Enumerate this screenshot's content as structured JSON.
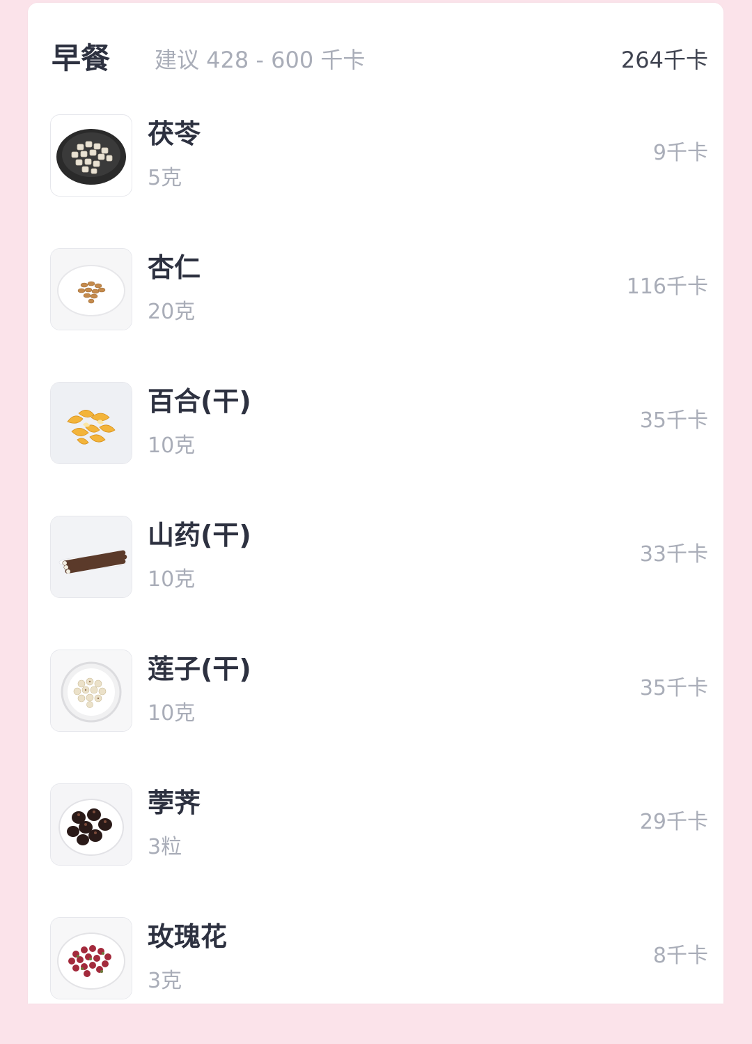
{
  "meal": {
    "title": "早餐",
    "suggestion": "建议 428 - 600 千卡",
    "total": "264千卡"
  },
  "items": [
    {
      "name": "茯苓",
      "amount": "5克",
      "kcal": "9千卡",
      "icon": "poria-image"
    },
    {
      "name": "杏仁",
      "amount": "20克",
      "kcal": "116千卡",
      "icon": "almond-image"
    },
    {
      "name": "百合(干)",
      "amount": "10克",
      "kcal": "35千卡",
      "icon": "dried-lily-image"
    },
    {
      "name": "山药(干)",
      "amount": "10克",
      "kcal": "33千卡",
      "icon": "dried-yam-image"
    },
    {
      "name": "莲子(干)",
      "amount": "10克",
      "kcal": "35千卡",
      "icon": "lotus-seed-image"
    },
    {
      "name": "荸荠",
      "amount": "3粒",
      "kcal": "29千卡",
      "icon": "water-chestnut-image"
    },
    {
      "name": "玫瑰花",
      "amount": "3克",
      "kcal": "8千卡",
      "icon": "rose-tea-image"
    }
  ],
  "colors": {
    "background": "#fbe3ea",
    "card": "#ffffff",
    "title": "#2d3140",
    "muted": "#a9adb8"
  }
}
